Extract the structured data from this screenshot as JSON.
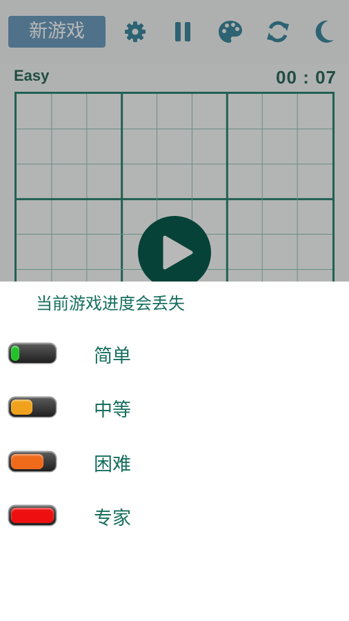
{
  "toolbar": {
    "new_game_label": "新游戏",
    "icons": [
      "gear-icon",
      "pause-icon",
      "palette-icon",
      "refresh-icon",
      "moon-icon"
    ]
  },
  "game": {
    "difficulty": "Easy",
    "timer": "00 : 07"
  },
  "sheet": {
    "warning": "当前游戏进度会丢失",
    "levels": [
      {
        "label": "简单",
        "fill_fraction": 0.2,
        "color": "#22c22a"
      },
      {
        "label": "中等",
        "fill_fraction": 0.5,
        "color": "#f0a21c"
      },
      {
        "label": "困难",
        "fill_fraction": 0.75,
        "color": "#f06a1c"
      },
      {
        "label": "专家",
        "fill_fraction": 1.0,
        "color": "#ee1010"
      }
    ]
  },
  "colors": {
    "accent": "#166e5e",
    "board_line": "#2e8574",
    "new_game_bg": "#6e9fc0",
    "play_button": "#0a5c4e"
  }
}
